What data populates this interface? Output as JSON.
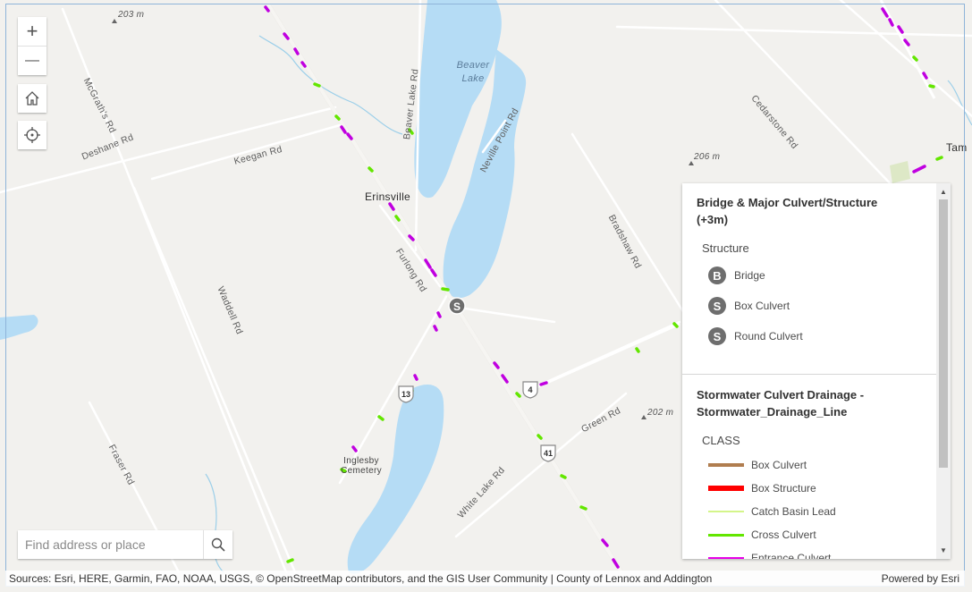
{
  "map": {
    "labels": {
      "beaver_lake": "Beaver Lake",
      "erinsville": "Erinsville",
      "inglesby_cemetery": "Inglesby Cemetery",
      "tam": "Tam",
      "mcgraths_rd": "McGrath's Rd",
      "deshane_rd": "Deshane Rd",
      "keegan_rd": "Keegan Rd",
      "beaver_lake_rd": "Beaver Lake Rd",
      "neville_point_rd": "Neville Point Rd",
      "cedarstone_rd": "Cedarstone Rd",
      "bradshaw_rd": "Bradshaw Rd",
      "furlong_rd": "Furlong Rd",
      "waddell_rd": "Waddell Rd",
      "green_rd": "Green Rd",
      "white_lake_rd": "White Lake Rd",
      "fraser_rd": "Fraser Rd",
      "elev_203": "203 m",
      "elev_206": "206 m",
      "elev_202": "202 m"
    },
    "shields": {
      "hwy13": "13",
      "hwy4": "4",
      "hwy41": "41"
    },
    "structure_marker": "S"
  },
  "controls": {
    "zoom_in": "+",
    "zoom_out": "—"
  },
  "search": {
    "placeholder": "Find address or place"
  },
  "attribution": {
    "sources": "Sources: Esri, HERE, Garmin, FAO, NOAA, USGS, © OpenStreetMap contributors, and the GIS User Community | County of Lennox and Addington",
    "powered_by": "Powered by Esri"
  },
  "legend": {
    "layer1": {
      "title": "Bridge & Major Culvert/Structure (+3m)",
      "field": "Structure",
      "items": [
        {
          "symbol": "B",
          "label": "Bridge"
        },
        {
          "symbol": "S",
          "label": "Box Culvert"
        },
        {
          "symbol": "S",
          "label": "Round Culvert"
        }
      ]
    },
    "layer2": {
      "title": "Stormwater Culvert Drainage - Stormwater_Drainage_Line",
      "field": "CLASS",
      "items": [
        {
          "label": "Box Culvert",
          "color": "#b07d4f"
        },
        {
          "label": "Box Structure",
          "color": "#ff0000"
        },
        {
          "label": "Catch Basin Lead",
          "color": "#d4f58a"
        },
        {
          "label": "Cross Culvert",
          "color": "#63e600"
        },
        {
          "label": "Entrance Culvert",
          "color": "#e600e6"
        }
      ]
    }
  }
}
